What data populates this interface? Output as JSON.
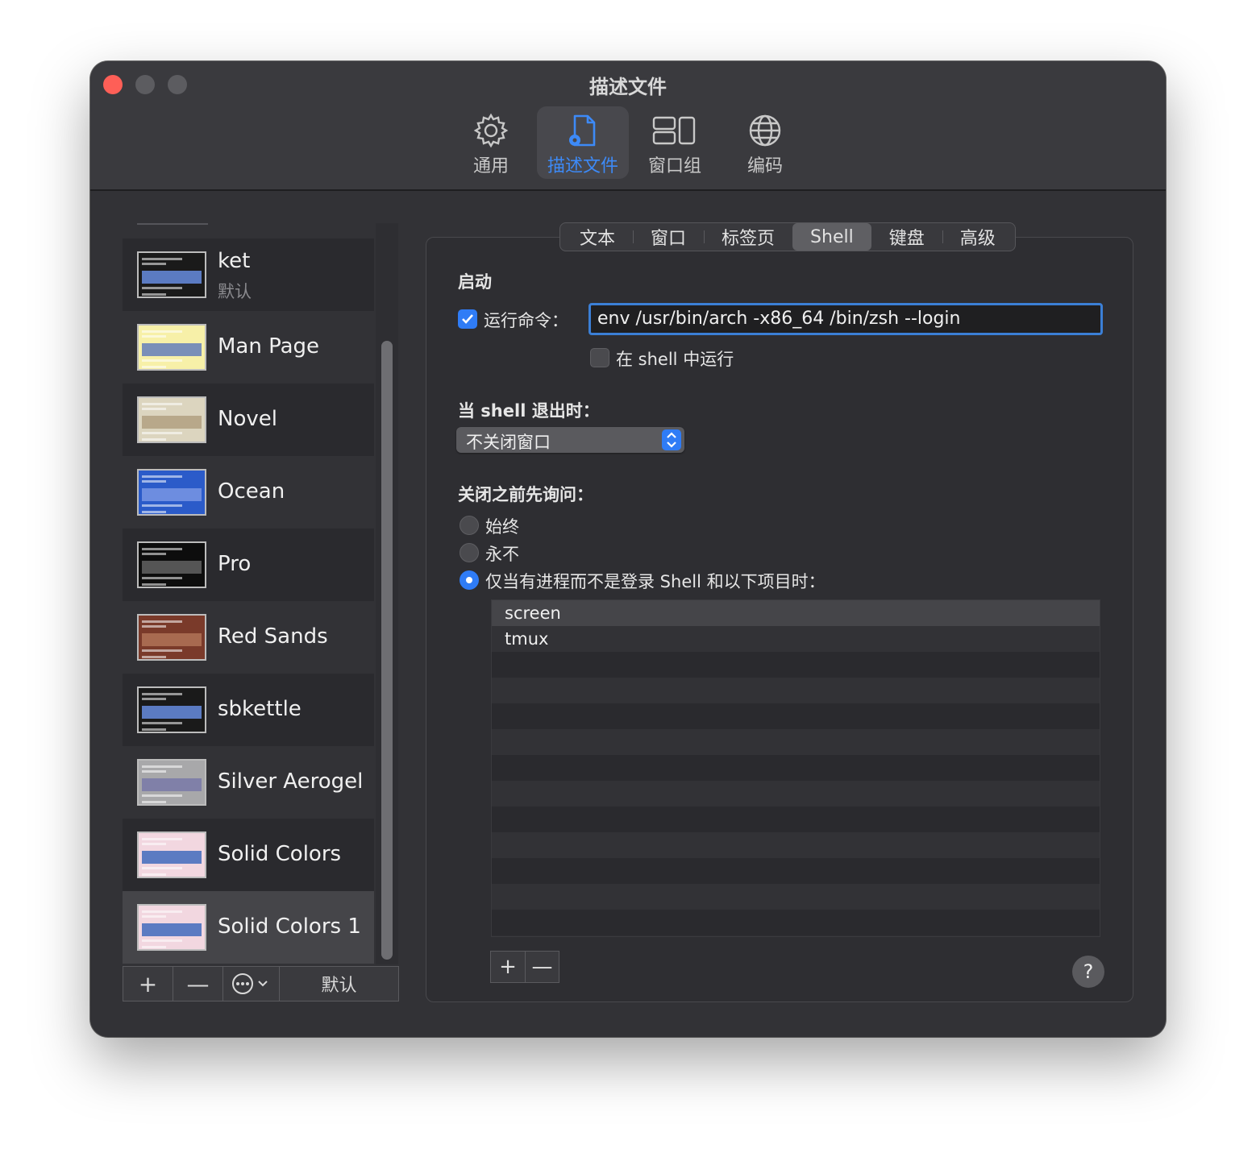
{
  "window": {
    "title": "描述文件"
  },
  "toolbar": {
    "items": [
      {
        "label": "通用",
        "icon": "gear-icon"
      },
      {
        "label": "描述文件",
        "icon": "profile-document-icon",
        "active": true
      },
      {
        "label": "窗口组",
        "icon": "window-groups-icon"
      },
      {
        "label": "编码",
        "icon": "globe-icon"
      }
    ]
  },
  "profiles": {
    "items": [
      {
        "name": "ket",
        "subtitle": "默认",
        "thumb_bg": "#1a1a1a",
        "thumb_band": "#5b7bc2"
      },
      {
        "name": "Man Page",
        "thumb_bg": "#f7f0a8",
        "thumb_band": "#7a8fb8"
      },
      {
        "name": "Novel",
        "thumb_bg": "#dcd5bf",
        "thumb_band": "#b8a88a"
      },
      {
        "name": "Ocean",
        "thumb_bg": "#2b5bc9",
        "thumb_band": "#6d8de0"
      },
      {
        "name": "Pro",
        "thumb_bg": "#0d0d0d",
        "thumb_band": "#555555"
      },
      {
        "name": "Red Sands",
        "thumb_bg": "#7a3a2a",
        "thumb_band": "#a86a50"
      },
      {
        "name": "sbkettle",
        "thumb_bg": "#1a1a1a",
        "thumb_band": "#5b7bc2"
      },
      {
        "name": "Silver Aerogel",
        "thumb_bg": "#a8a8aa",
        "thumb_band": "#8080a8"
      },
      {
        "name": "Solid Colors",
        "thumb_bg": "#f2d7e0",
        "thumb_band": "#5b7bc2"
      },
      {
        "name": "Solid Colors 1",
        "thumb_bg": "#f2d7e0",
        "thumb_band": "#5b7bc2"
      }
    ],
    "buttons": {
      "add": "+",
      "remove": "—",
      "default": "默认"
    }
  },
  "tabs": [
    "文本",
    "窗口",
    "标签页",
    "Shell",
    "键盘",
    "高级"
  ],
  "active_tab": "Shell",
  "startup": {
    "heading": "启动",
    "run_command_label": "运行命令：",
    "run_command_checked": true,
    "run_command_value": "env /usr/bin/arch -x86_64 /bin/zsh --login",
    "run_in_shell_label": "在 shell 中运行",
    "run_in_shell_checked": false
  },
  "on_exit": {
    "heading": "当 shell 退出时：",
    "selected": "不关闭窗口"
  },
  "ask_before_close": {
    "heading": "关闭之前先询问：",
    "options": [
      "始终",
      "永不",
      "仅当有进程而不是登录 Shell 和以下项目时："
    ],
    "selected_index": 2,
    "processes": [
      "screen",
      "tmux"
    ],
    "buttons": {
      "add": "+",
      "remove": "—"
    }
  },
  "help": "?",
  "colors": {
    "accent": "#2f7cf6",
    "close": "#fe5f57"
  }
}
